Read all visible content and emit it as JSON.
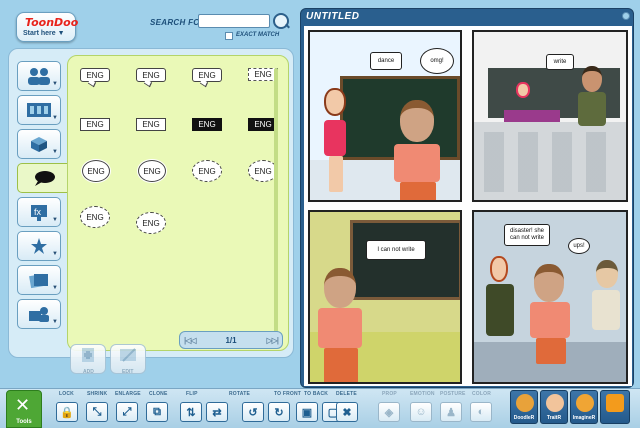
{
  "header": {
    "logo_text": "ToonDoo",
    "start_here": "Start here ▼",
    "search_label": "SEARCH FOR",
    "search_value": "",
    "exact_match_label": "EXACT MATCH"
  },
  "categories": [
    {
      "name": "characters"
    },
    {
      "name": "backgrounds"
    },
    {
      "name": "props"
    },
    {
      "name": "speech-bubbles"
    },
    {
      "name": "special-effects"
    },
    {
      "name": "stickers"
    },
    {
      "name": "images"
    },
    {
      "name": "my-content"
    }
  ],
  "bubbles": {
    "rows": [
      [
        {
          "text": "ENG",
          "style": "speech"
        },
        {
          "text": "ENG",
          "style": "speech"
        },
        {
          "text": "ENG",
          "style": "speech"
        },
        {
          "text": "ENG",
          "style": "dash"
        }
      ],
      [
        {
          "text": "ENG",
          "style": "box"
        },
        {
          "text": "ENG",
          "style": "box"
        },
        {
          "text": "ENG",
          "style": "black"
        },
        {
          "text": "ENG",
          "style": "black"
        }
      ],
      [
        {
          "text": "ENG",
          "style": "cloud"
        },
        {
          "text": "ENG",
          "style": "cloud"
        },
        {
          "text": "ENG",
          "style": "spiky"
        },
        {
          "text": "ENG",
          "style": "spiky"
        }
      ],
      [
        {
          "text": "ENG",
          "style": "spiky"
        },
        {
          "text": "ENG",
          "style": "spiky"
        }
      ]
    ]
  },
  "pager": {
    "first": "|◁◁",
    "page": "1/1",
    "last": "▷▷|"
  },
  "side_actions": {
    "add": "ADD",
    "edit": "EDIT"
  },
  "strip": {
    "title": "UNTITLED",
    "panel1": {
      "bubble1": "dance",
      "bubble2": "omg!"
    },
    "panel2": {
      "bubble1": "write"
    },
    "panel3": {
      "bubble1": "I can not write"
    },
    "panel4": {
      "bubble1": "disaster! she can not write",
      "bubble2": "ups!"
    }
  },
  "toolbar": {
    "tools_label": "Tools",
    "buttons": [
      {
        "label": "LOCK",
        "icon": "lock-icon",
        "glyph": "🔒",
        "enabled": true
      },
      {
        "label": "SHRINK",
        "icon": "shrink-icon",
        "glyph": "⤡",
        "enabled": true
      },
      {
        "label": "ENLARGE",
        "icon": "enlarge-icon",
        "glyph": "⤢",
        "enabled": true
      },
      {
        "label": "CLONE",
        "icon": "clone-icon",
        "glyph": "⧉",
        "enabled": true
      },
      {
        "label": "FLIP",
        "icon": "flip-vertical-icon",
        "glyph": "⇅",
        "enabled": true
      },
      {
        "label": "",
        "icon": "flip-horizontal-icon",
        "glyph": "⇄",
        "enabled": true
      },
      {
        "label": "ROTATE",
        "icon": "rotate-left-icon",
        "glyph": "↺",
        "enabled": true
      },
      {
        "label": "",
        "icon": "rotate-right-icon",
        "glyph": "↻",
        "enabled": true
      },
      {
        "label": "TO FRONT",
        "icon": "to-front-icon",
        "glyph": "▣",
        "enabled": true
      },
      {
        "label": "TO BACK",
        "icon": "to-back-icon",
        "glyph": "▢",
        "enabled": true
      },
      {
        "label": "DELETE",
        "icon": "delete-icon",
        "glyph": "✖",
        "enabled": true
      },
      {
        "label": "PROP",
        "icon": "prop-icon",
        "glyph": "◈",
        "enabled": false
      },
      {
        "label": "EMOTION",
        "icon": "emotion-icon",
        "glyph": "☺",
        "enabled": false
      },
      {
        "label": "POSTURE",
        "icon": "posture-icon",
        "glyph": "♟",
        "enabled": false
      },
      {
        "label": "COLOR",
        "icon": "color-icon",
        "glyph": "◐",
        "enabled": false
      }
    ],
    "apps": [
      {
        "label": "DoodleR",
        "color": "#e8a23a"
      },
      {
        "label": "TraitR",
        "color": "#f2c49b"
      },
      {
        "label": "ImagineR",
        "color": "#f0a534"
      },
      {
        "label": "",
        "color": "#f39b1c"
      }
    ]
  }
}
